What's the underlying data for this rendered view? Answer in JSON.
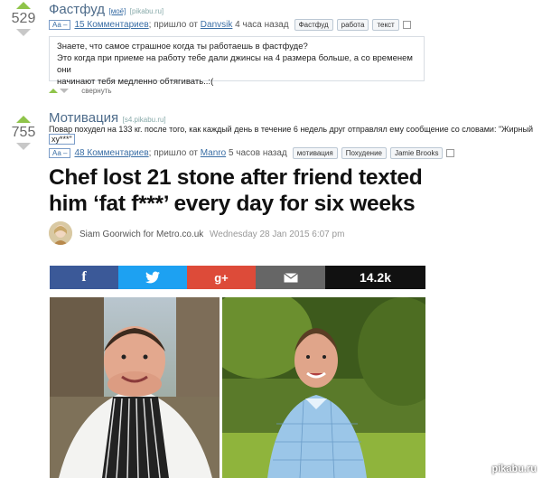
{
  "post1": {
    "score": "529",
    "title": "Фастфуд",
    "badge": "[моё]",
    "source": "[pikabu.ru]",
    "aa": "Aa –",
    "comments": "15 Комментариев",
    "meta_middle": "; пришло от",
    "author": "Danvsik",
    "time_ago": "4 часа назад",
    "tags": [
      "Фастфуд",
      "работа",
      "текст"
    ],
    "text_lines": [
      "Знаете, что самое страшное когда ты работаешь в фастфуде?",
      "Это когда при приеме на работу тебе дали джинсы на 4 размера больше, а со временем они",
      "начинают тебя медленно обтягивать..:("
    ],
    "collapse": "свернуть"
  },
  "post2": {
    "score": "755",
    "title": "Мотивация",
    "source": "[s4.pikabu.ru]",
    "desc_line1": "Повар похудел на 133 кг. после того, как каждый день в течение 6 недель друг отправлял ему сообщение со словами: \"Жирный",
    "desc_line2": "ху***\"",
    "aa": "Aa –",
    "comments": "48 Комментариев",
    "meta_middle": "; пришло от",
    "author": "Manro",
    "time_ago": "5 часов назад",
    "tags": [
      "мотивация",
      "Похудение",
      "Jamie Brooks"
    ]
  },
  "article": {
    "headline_line1": "Chef lost 21 stone after friend texted",
    "headline_line2": "him ‘fat f***’ every day for six weeks",
    "byline_author": "Siam Goorwich for Metro.co.uk",
    "byline_date": "Wednesday 28 Jan 2015 6:07 pm",
    "share_count": "14.2k",
    "social_colors": {
      "facebook": "#3b5998",
      "twitter": "#1da1f2",
      "googleplus": "#dd4b39",
      "email": "#666666",
      "count_bg": "#111111"
    }
  },
  "watermark": "pikabu.ru"
}
